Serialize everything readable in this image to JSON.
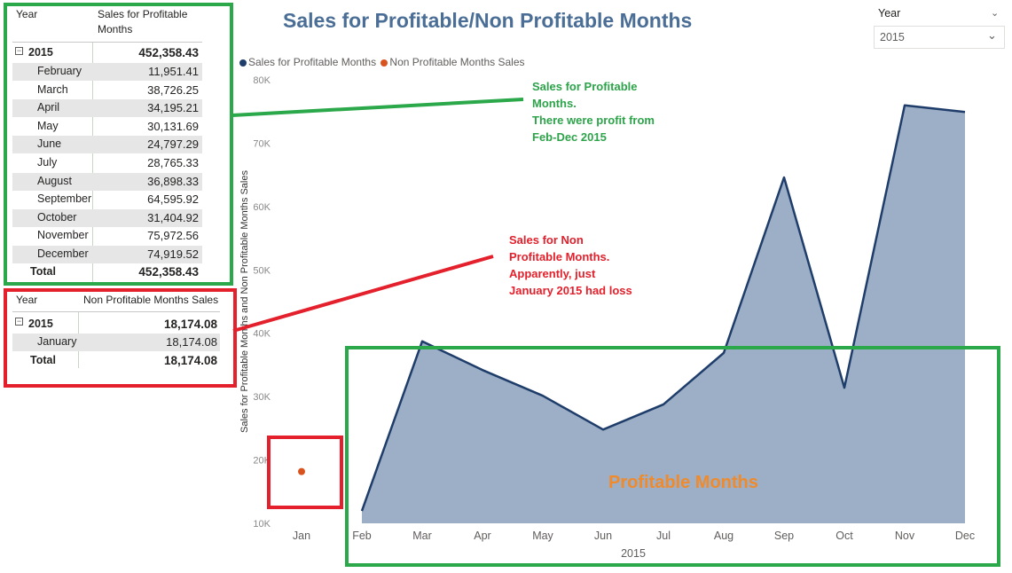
{
  "title": "Sales for Profitable/Non Profitable Months",
  "slicer": {
    "label": "Year",
    "value": "2015"
  },
  "legend": [
    {
      "name": "Sales for Profitable Months",
      "color": "#1f3d6a"
    },
    {
      "name": "Non Profitable Months Sales",
      "color": "#d9531e"
    }
  ],
  "profitable_table": {
    "col1": "Year",
    "col2_line1": "Sales for Profitable",
    "col2_line2": "Months",
    "group_label": "2015",
    "group_total": "452,358.43",
    "rows": [
      {
        "month": "February",
        "value": "11,951.41"
      },
      {
        "month": "March",
        "value": "38,726.25"
      },
      {
        "month": "April",
        "value": "34,195.21"
      },
      {
        "month": "May",
        "value": "30,131.69"
      },
      {
        "month": "June",
        "value": "24,797.29"
      },
      {
        "month": "July",
        "value": "28,765.33"
      },
      {
        "month": "August",
        "value": "36,898.33"
      },
      {
        "month": "September",
        "value": "64,595.92"
      },
      {
        "month": "October",
        "value": "31,404.92"
      },
      {
        "month": "November",
        "value": "75,972.56"
      },
      {
        "month": "December",
        "value": "74,919.52"
      }
    ],
    "total_label": "Total",
    "total_value": "452,358.43"
  },
  "non_profitable_table": {
    "col1": "Year",
    "col2": "Non Profitable Months Sales",
    "group_label": "2015",
    "group_total": "18,174.08",
    "rows": [
      {
        "month": "January",
        "value": "18,174.08"
      }
    ],
    "total_label": "Total",
    "total_value": "18,174.08"
  },
  "annotations": {
    "green": [
      "Sales for Profitable",
      "Months.",
      "There were profit from",
      "Feb-Dec 2015"
    ],
    "red": [
      "Sales for Non",
      "Profitable Months.",
      "Apparently, just",
      "January 2015 had loss"
    ],
    "profitable_label": "Profitable Months"
  },
  "colors": {
    "green_box": "#2aa84a",
    "red_box": "#e3202b",
    "area_fill": "#9dafc6",
    "line": "#1f3d6a",
    "dot": "#d9531e",
    "title": "#4a6e96",
    "orange_text": "#f08a2a"
  },
  "chart_data": {
    "type": "area",
    "title": "Sales for Profitable/Non Profitable Months",
    "ylabel": "Sales for Profitable Months and Non Profitable Months Sales",
    "xlabel": "2015",
    "categories": [
      "Jan",
      "Feb",
      "Mar",
      "Apr",
      "May",
      "Jun",
      "Jul",
      "Aug",
      "Sep",
      "Oct",
      "Nov",
      "Dec"
    ],
    "y_ticks": [
      "10K",
      "20K",
      "30K",
      "40K",
      "50K",
      "60K",
      "70K",
      "80K"
    ],
    "ylim": [
      10000,
      80000
    ],
    "series": [
      {
        "name": "Sales for Profitable Months",
        "type": "area",
        "values": [
          null,
          11951.41,
          38726.25,
          34195.21,
          30131.69,
          24797.29,
          28765.33,
          36898.33,
          64595.92,
          31404.92,
          75972.56,
          74919.52
        ]
      },
      {
        "name": "Non Profitable Months Sales",
        "type": "scatter",
        "values": [
          18174.08,
          null,
          null,
          null,
          null,
          null,
          null,
          null,
          null,
          null,
          null,
          null
        ]
      }
    ],
    "legend_position": "top-left"
  }
}
